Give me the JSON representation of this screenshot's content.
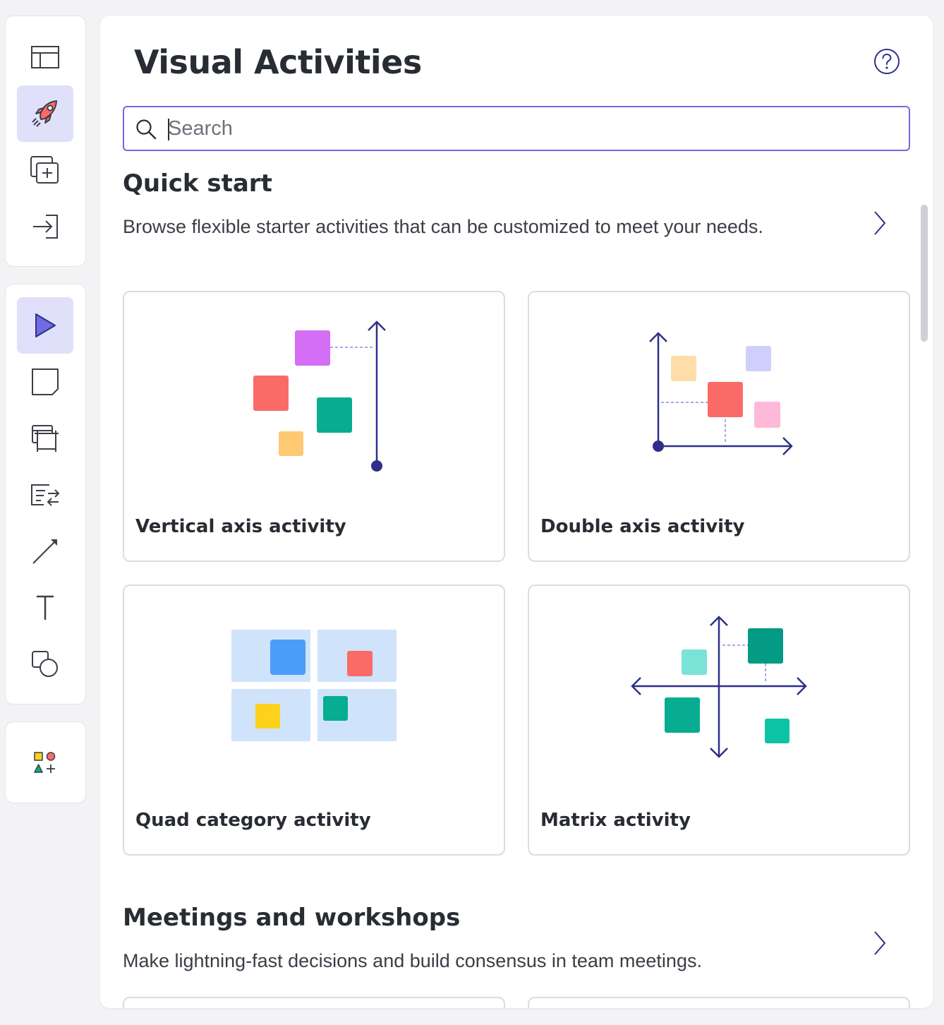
{
  "panel": {
    "title": "Visual Activities",
    "help_icon": "help-circle-icon"
  },
  "search": {
    "placeholder": "Search",
    "value": ""
  },
  "sections": [
    {
      "title": "Quick start",
      "description": "Browse flexible starter activities that can be customized to meet your needs.",
      "cards": [
        {
          "label": "Vertical axis activity"
        },
        {
          "label": "Double axis activity"
        },
        {
          "label": "Quad category activity"
        },
        {
          "label": "Matrix activity"
        }
      ]
    },
    {
      "title": "Meetings and workshops",
      "description": "Make lightning-fast decisions and build consensus in team meetings."
    }
  ],
  "toolbar": {
    "group1": [
      "template-icon",
      "rocket-icon",
      "add-frame-icon",
      "import-icon"
    ],
    "group2": [
      "select-arrow-icon",
      "sticky-note-icon",
      "frame-icon",
      "table-swap-icon",
      "line-icon",
      "text-icon",
      "shapes-icon"
    ],
    "group3": [
      "shape-library-icon"
    ],
    "active": [
      "rocket-icon",
      "select-arrow-icon"
    ]
  },
  "colors": {
    "accent": "#6f6be0",
    "active_bg": "#e1e0fb",
    "axis": "#2e2f8a",
    "purple": "#d36ef5",
    "red": "#fa6b68",
    "teal": "#06ad91",
    "orange": "#ffc973",
    "peach": "#ffddaa",
    "lavender": "#cfcffc",
    "pink": "#ffb9d8",
    "blue": "#4b9dfa",
    "yellow": "#fcd21c",
    "mint": "#7ae3d6",
    "quad_bg": "#cfe3fb"
  }
}
